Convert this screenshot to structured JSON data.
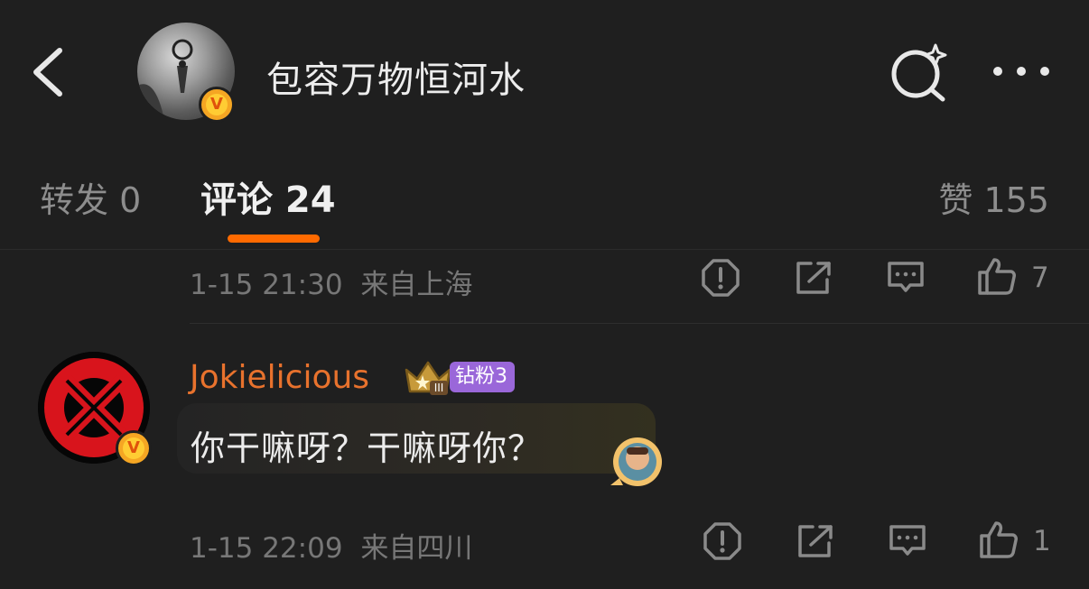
{
  "header": {
    "title": "包容万物恒河水",
    "verified_mark": "V"
  },
  "tabs": {
    "repost": "转发 0",
    "comments": "评论 24",
    "likes": "赞 155"
  },
  "comments": [
    {
      "time": "1-15 21:30",
      "location": "来自上海",
      "likes": "7"
    },
    {
      "username": "Jokielicious",
      "crown_level": "III",
      "fan_badge": "钻粉3",
      "text": "你干嘛呀？干嘛呀你？",
      "time": "1-15 22:09",
      "location": "来自四川",
      "likes": "1"
    }
  ],
  "icons": {
    "back": "chevron-left-icon",
    "search": "sparkle-search-icon",
    "more": "more-dots-icon",
    "report": "report-icon",
    "share": "share-icon",
    "reply": "comment-icon",
    "like": "thumbs-up-icon"
  },
  "colors": {
    "background": "#1f1f1f",
    "accent": "#ff6a00",
    "username": "#e8722d",
    "fan_badge": "#9a67d9",
    "verified": "#f5a623"
  }
}
